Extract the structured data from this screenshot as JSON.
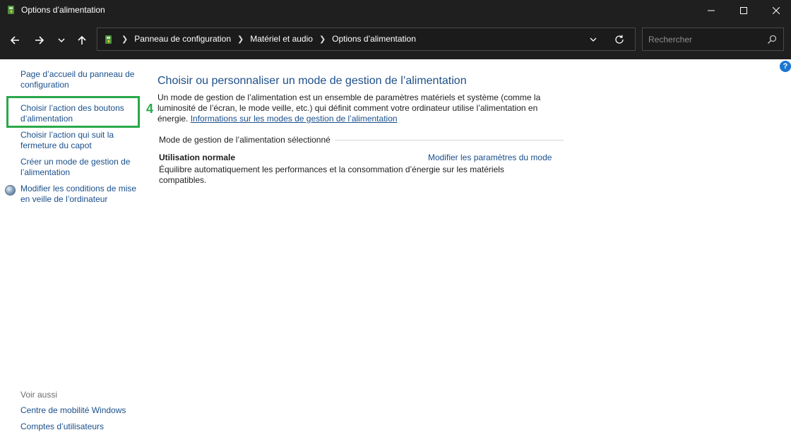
{
  "window": {
    "title": "Options d’alimentation"
  },
  "address_bar": {
    "breadcrumbs": [
      "Panneau de configuration",
      "Matériel et audio",
      "Options d’alimentation"
    ],
    "search_placeholder": "Rechercher"
  },
  "sidebar": {
    "links": [
      "Page d’accueil du panneau de configuration",
      "Choisir l’action des boutons d’alimentation",
      "Choisir l’action qui suit la fermeture du capot",
      "Créer un mode de gestion de l’alimentation",
      "Modifier les conditions de mise en veille de l’ordinateur"
    ],
    "annotation_number": "4",
    "see_also_heading": "Voir aussi",
    "see_also_links": [
      "Centre de mobilité Windows",
      "Comptes d’utilisateurs"
    ]
  },
  "main": {
    "title": "Choisir ou personnaliser un mode de gestion de l’alimentation",
    "description": "Un mode de gestion de l’alimentation est un ensemble de paramètres matériels et système (comme la luminosité de l’écran, le mode veille, etc.) qui définit comment votre ordinateur utilise l’alimentation en énergie.",
    "info_link": "Informations sur les modes de gestion de l’alimentation",
    "section_label": "Mode de gestion de l’alimentation sélectionné",
    "plan": {
      "name": "Utilisation normale",
      "change_link": "Modifier les paramètres du mode",
      "description": "Équilibre automatiquement les performances et la consommation d’énergie sur les matériels compatibles."
    },
    "help_label": "?"
  },
  "colors": {
    "titlebar_bg": "#1f1f1f",
    "link": "#1a4f8b",
    "highlight": "#2aa84a"
  }
}
